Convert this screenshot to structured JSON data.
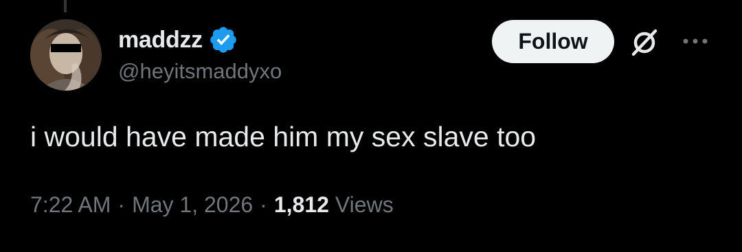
{
  "tweet": {
    "author": {
      "display_name": "maddzz",
      "handle": "@heyitsmaddyxo",
      "verified": true,
      "verified_color": "#1d9bf0",
      "avatar": "avatar-photo"
    },
    "follow_label": "Follow",
    "text": "i would have made him my sex slave too",
    "time": "7:22 AM",
    "separator": "·",
    "date": "May 1, 2026",
    "views_count": "1,812",
    "views_label": "Views",
    "icons": {
      "grok": "grok-icon",
      "more": "more-icon"
    }
  },
  "theme": {
    "background": "#000000",
    "text_primary": "#e7e9ea",
    "text_secondary": "#71767b",
    "button_bg": "#eff3f4",
    "button_text": "#0f1419"
  }
}
